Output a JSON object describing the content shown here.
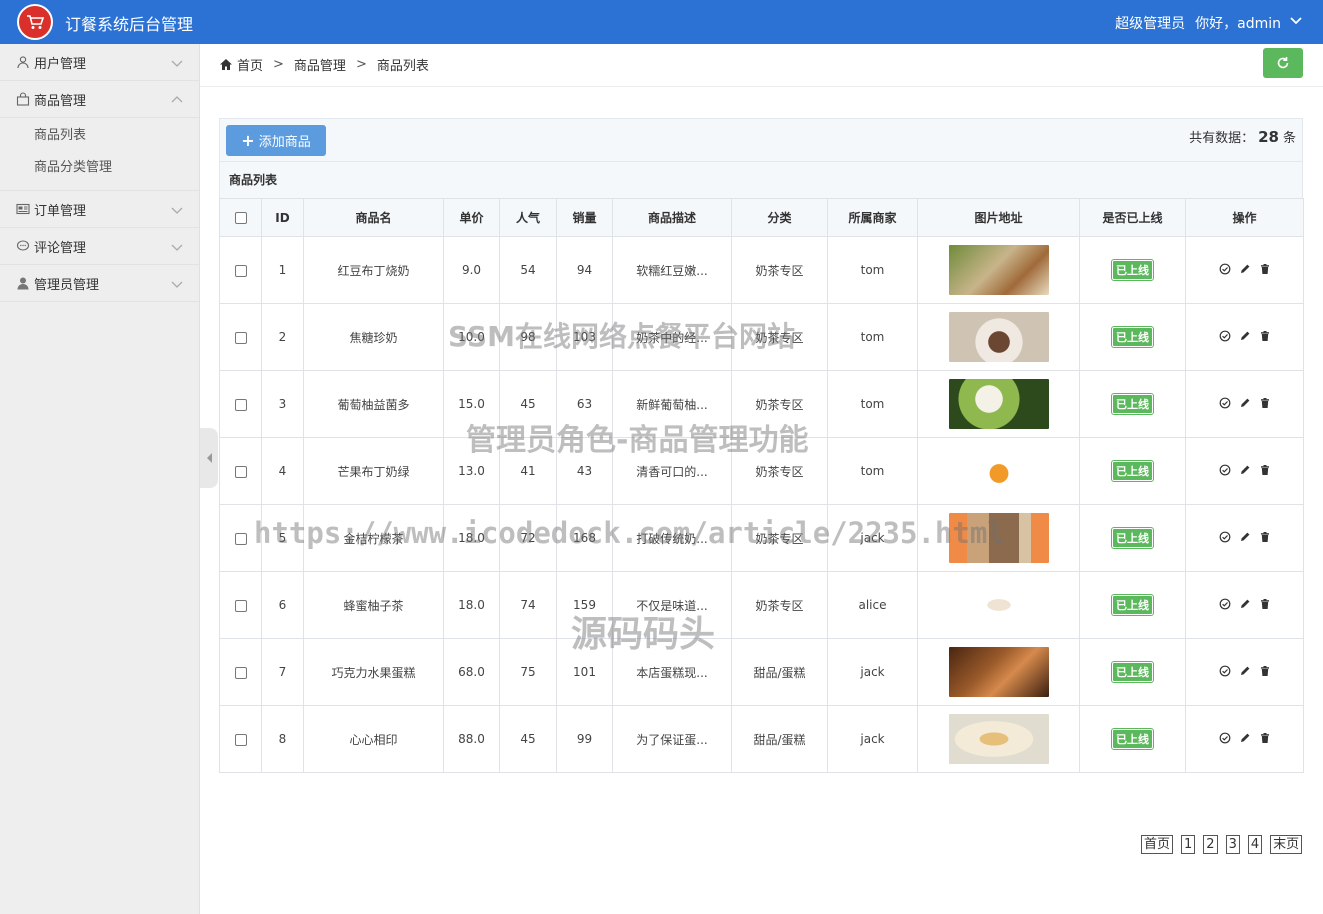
{
  "header": {
    "title": "订餐系统后台管理",
    "role": "超级管理员",
    "greeting": "你好，admin"
  },
  "sidebar": {
    "items": [
      {
        "label": "用户管理",
        "icon": "user-icon"
      },
      {
        "label": "商品管理",
        "icon": "shopping-bag-icon",
        "expanded": true,
        "children": [
          {
            "label": "商品列表"
          },
          {
            "label": "商品分类管理"
          }
        ]
      },
      {
        "label": "订单管理",
        "icon": "order-icon"
      },
      {
        "label": "评论管理",
        "icon": "comment-icon"
      },
      {
        "label": "管理员管理",
        "icon": "admin-user-icon"
      }
    ]
  },
  "breadcrumb": {
    "home": "首页",
    "level1": "商品管理",
    "level2": "商品列表"
  },
  "toolbar": {
    "add_label": "添加商品",
    "total_prefix": "共有数据：",
    "total_count": "28",
    "total_suffix": "条"
  },
  "table": {
    "title": "商品列表",
    "columns": [
      "ID",
      "商品名",
      "单价",
      "人气",
      "销量",
      "商品描述",
      "分类",
      "所属商家",
      "图片地址",
      "是否已上线",
      "操作"
    ],
    "rows": [
      {
        "id": "1",
        "name": "红豆布丁烧奶",
        "price": "9.0",
        "popularity": "54",
        "sales": "94",
        "desc": "软糯红豆嫩...",
        "category": "奶茶专区",
        "merchant": "tom",
        "status": "已上线",
        "image": "iced-milk-tea"
      },
      {
        "id": "2",
        "name": "焦糖珍奶",
        "price": "10.0",
        "popularity": "98",
        "sales": "103",
        "desc": "奶茶中的经...",
        "category": "奶茶专区",
        "merchant": "tom",
        "status": "已上线",
        "image": "caramel-milk"
      },
      {
        "id": "3",
        "name": "葡萄柚益菌多",
        "price": "15.0",
        "popularity": "45",
        "sales": "63",
        "desc": "新鲜葡萄柚...",
        "category": "奶茶专区",
        "merchant": "tom",
        "status": "已上线",
        "image": "cream-drink"
      },
      {
        "id": "4",
        "name": "芒果布丁奶绿",
        "price": "13.0",
        "popularity": "41",
        "sales": "43",
        "desc": "清香可口的...",
        "category": "奶茶专区",
        "merchant": "tom",
        "status": "已上线",
        "image": "orange-drink"
      },
      {
        "id": "5",
        "name": "金桔柠檬茶",
        "price": "18.0",
        "popularity": "72",
        "sales": "168",
        "desc": "打破传统奶...",
        "category": "奶茶专区",
        "merchant": "jack",
        "status": "已上线",
        "image": "lemon-tea"
      },
      {
        "id": "6",
        "name": "蜂蜜柚子茶",
        "price": "18.0",
        "popularity": "74",
        "sales": "159",
        "desc": "不仅是味道...",
        "category": "奶茶专区",
        "merchant": "alice",
        "status": "已上线",
        "image": "honey-tea"
      },
      {
        "id": "7",
        "name": "巧克力水果蛋糕",
        "price": "68.0",
        "popularity": "75",
        "sales": "101",
        "desc": "本店蛋糕现...",
        "category": "甜品/蛋糕",
        "merchant": "jack",
        "status": "已上线",
        "image": "chocolate-cake"
      },
      {
        "id": "8",
        "name": "心心相印",
        "price": "88.0",
        "popularity": "45",
        "sales": "99",
        "desc": "为了保证蛋...",
        "category": "甜品/蛋糕",
        "merchant": "jack",
        "status": "已上线",
        "image": "dessert-plate"
      }
    ]
  },
  "pagination": {
    "first": "首页",
    "pages": [
      "1",
      "2",
      "3",
      "4"
    ],
    "last": "末页"
  },
  "watermarks": {
    "line1": "SSM在线网络点餐平台网站",
    "line2": "管理员角色-商品管理功能",
    "line3": "https://www.icodedock.com/article/2235.html",
    "line4": "源码码头"
  },
  "colors": {
    "header": "#2b72d4",
    "add_button": "#5b9bde",
    "refresh_button": "#5cb85c",
    "status_badge": "#5cb85c"
  }
}
